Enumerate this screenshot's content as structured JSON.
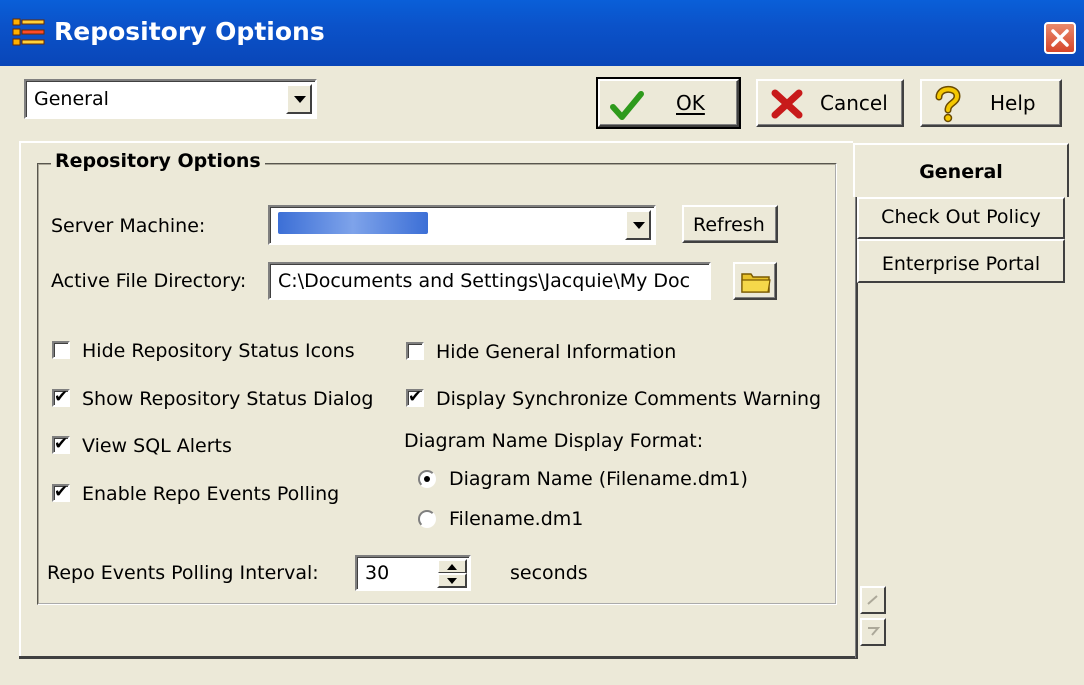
{
  "window": {
    "title": "Repository Options"
  },
  "view_select": {
    "value": "General"
  },
  "buttons": {
    "ok": "OK",
    "cancel": "Cancel",
    "help": "Help"
  },
  "group": {
    "title": "Repository Options"
  },
  "server": {
    "label": "Server Machine:",
    "refresh": "Refresh"
  },
  "directory": {
    "label": "Active File Directory:",
    "value": "C:\\Documents and Settings\\Jacquie\\My Doc"
  },
  "checkboxes_left": [
    {
      "label": "Hide Repository Status Icons",
      "checked": false
    },
    {
      "label": "Show Repository Status Dialog",
      "checked": true
    },
    {
      "label": "View SQL Alerts",
      "checked": true
    },
    {
      "label": "Enable Repo Events Polling",
      "checked": true
    }
  ],
  "checkboxes_right": [
    {
      "label": "Hide General Information",
      "checked": false
    },
    {
      "label": "Display Synchronize Comments Warning",
      "checked": true
    }
  ],
  "diagram_format": {
    "label": "Diagram Name Display Format:",
    "options": [
      {
        "label": "Diagram Name (Filename.dm1)",
        "selected": true
      },
      {
        "label": "Filename.dm1",
        "selected": false
      }
    ]
  },
  "polling": {
    "label": "Repo Events Polling Interval:",
    "value": "30",
    "unit": "seconds"
  },
  "tabs": [
    {
      "label": "General",
      "active": true
    },
    {
      "label": "Check Out Policy",
      "active": false
    },
    {
      "label": "Enterprise Portal",
      "active": false
    }
  ],
  "colors": {
    "titlebar": "#0b52c9",
    "face": "#ece9d8",
    "ok_check": "#2e9a1c",
    "cancel_x": "#c81a1a",
    "help_q": "#e8b400",
    "folder": "#e8c22a"
  }
}
